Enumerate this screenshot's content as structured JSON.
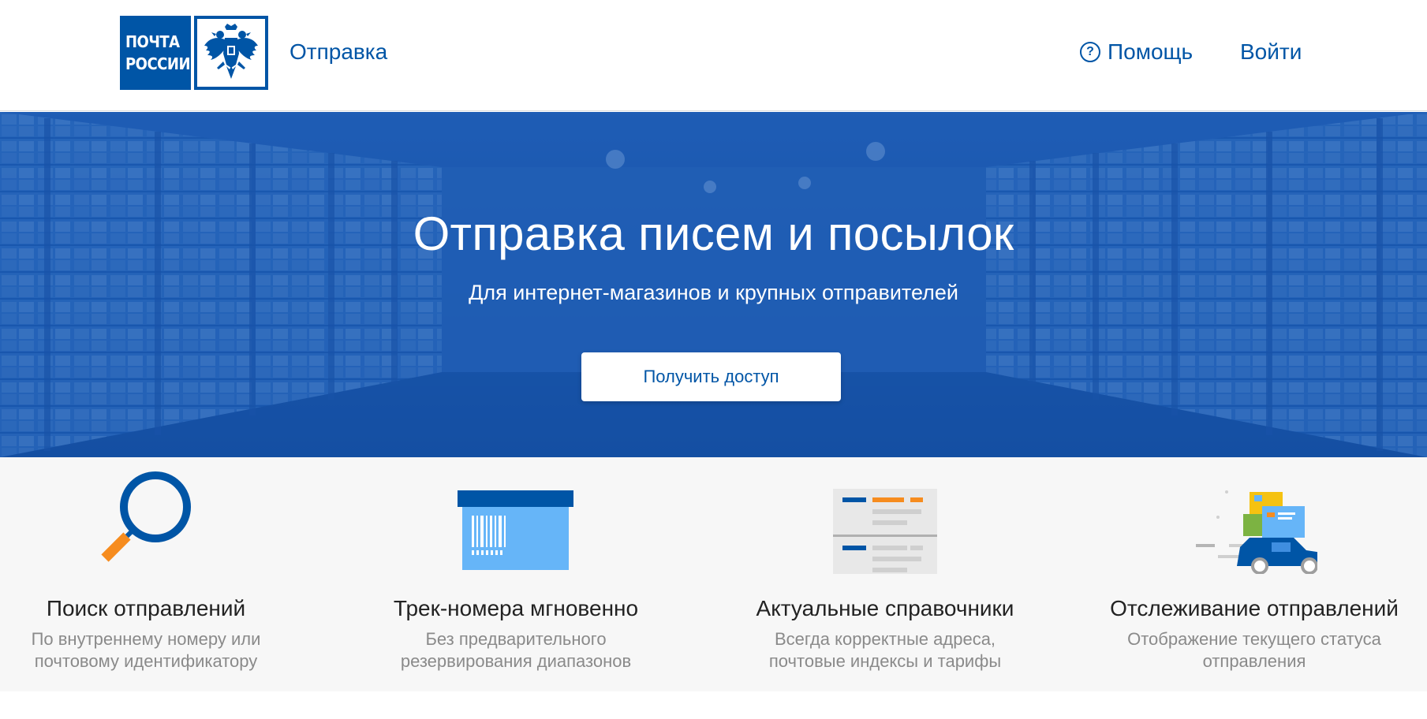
{
  "header": {
    "logo_line1": "ПОЧТА",
    "logo_line2": "РОССИИ",
    "nav_label": "Отправка",
    "help_icon_glyph": "?",
    "help_label": "Помощь",
    "login_label": "Войти"
  },
  "hero": {
    "title": "Отправка писем и посылок",
    "subtitle": "Для интернет-магазинов и крупных отправителей",
    "cta_label": "Получить доступ"
  },
  "features": [
    {
      "icon": "magnifier-icon",
      "title": "Поиск отправлений",
      "desc_line1": "По внутреннему номеру или",
      "desc_line2": "почтовому идентификатору"
    },
    {
      "icon": "barcode-box-icon",
      "title": "Трек-номера мгновенно",
      "desc_line1": "Без предварительного",
      "desc_line2": "резервирования диапазонов"
    },
    {
      "icon": "reference-document-icon",
      "title": "Актуальные справочники",
      "desc_line1": "Всегда корректные адреса,",
      "desc_line2": "почтовые индексы и тарифы"
    },
    {
      "icon": "car-with-parcels-icon",
      "title": "Отслеживание отправлений",
      "desc_line1": "Отображение текущего статуса",
      "desc_line2": "отправления"
    }
  ],
  "colors": {
    "brand_blue": "#0055a6",
    "hero_blue": "#1e5fb4",
    "accent_orange": "#f68c1f",
    "light_blue": "#66b5f8",
    "feature_bg": "#f7f7f7",
    "muted_text": "#8a8a8a"
  }
}
